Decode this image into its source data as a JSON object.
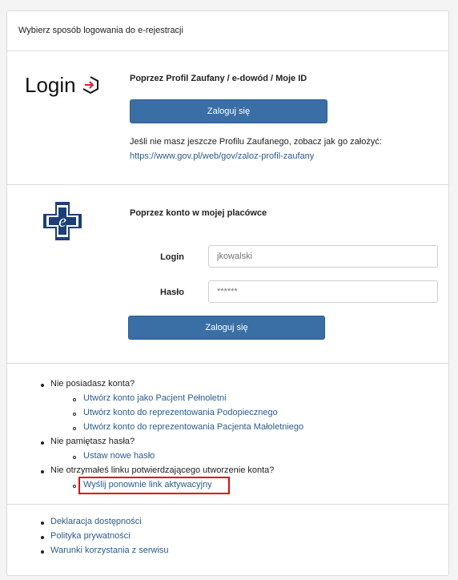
{
  "header": {
    "title": "Wybierz sposób logowania do e-rejestracji"
  },
  "profil": {
    "logo_text": "Login",
    "heading": "Poprzez Profil Zaufany / e-dowód / Moje ID",
    "button": "Zaloguj się",
    "info": "Jeśli nie masz jeszcze Profilu Zaufanego, zobacz jak go założyć:",
    "link": "https://www.gov.pl/web/gov/zaloz-profil-zaufany"
  },
  "konto": {
    "heading": "Poprzez konto w mojej placówce",
    "login_label": "Login",
    "login_placeholder": "jkowalski",
    "password_label": "Hasło",
    "password_placeholder": "******",
    "button": "Zaloguj się"
  },
  "help": {
    "q1": "Nie posiadasz konta?",
    "q1_links": [
      "Utwórz konto jako Pacjent Pełnoletni",
      "Utwórz konto do reprezentowania Podopiecznego",
      "Utwórz konto do reprezentowania Pacjenta Małoletniego"
    ],
    "q2": "Nie pamiętasz hasła?",
    "q2_links": [
      "Ustaw nowe hasło"
    ],
    "q3": "Nie otrzymałeś linku potwierdzającego utworzenie konta?",
    "q3_links": [
      "Wyślij ponownie link aktywacyjny"
    ]
  },
  "footer": {
    "links": [
      "Deklaracja dostępności",
      "Polityka prywatności",
      "Warunki korzystania z serwisu"
    ]
  },
  "colors": {
    "button": "#3a6fa6",
    "link": "#2b5b8d",
    "highlight": "#e30b0b"
  }
}
